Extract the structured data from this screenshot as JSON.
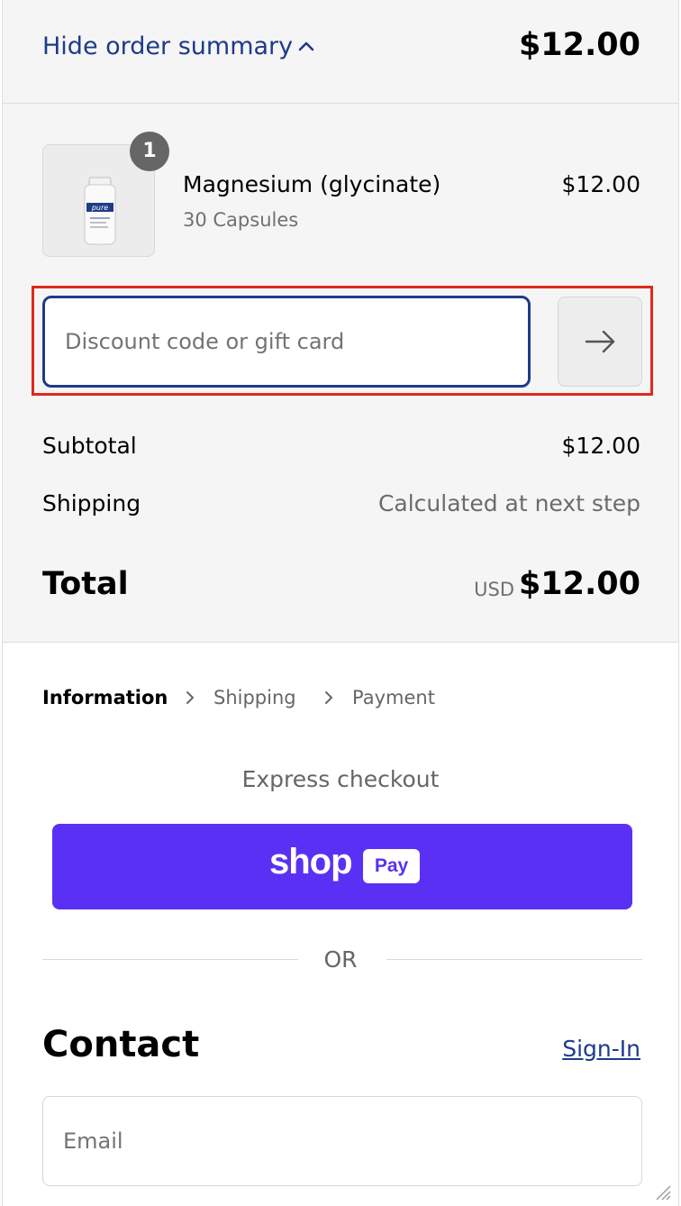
{
  "summary_toggle": {
    "label": "Hide order summary",
    "total": "$12.00"
  },
  "product": {
    "quantity": "1",
    "name": "Magnesium (glycinate)",
    "variant": "30 Capsules",
    "price": "$12.00",
    "image_label": "pure"
  },
  "discount": {
    "placeholder": "Discount code or gift card",
    "apply_icon": "arrow-right-icon"
  },
  "costs": {
    "subtotal_label": "Subtotal",
    "subtotal_value": "$12.00",
    "shipping_label": "Shipping",
    "shipping_value": "Calculated at next step",
    "total_label": "Total",
    "currency": "USD",
    "total_value": "$12.00"
  },
  "breadcrumbs": [
    "Information",
    "Shipping",
    "Payment"
  ],
  "express": {
    "title": "Express checkout",
    "shop_word": "shop",
    "pay_word": "Pay",
    "or_text": "OR"
  },
  "contact": {
    "title": "Contact",
    "signin_label": "Sign-In",
    "email_placeholder": "Email"
  },
  "colors": {
    "accent": "#1e3a8a",
    "shoppay": "#5a31f4",
    "highlight": "#e0281c"
  }
}
